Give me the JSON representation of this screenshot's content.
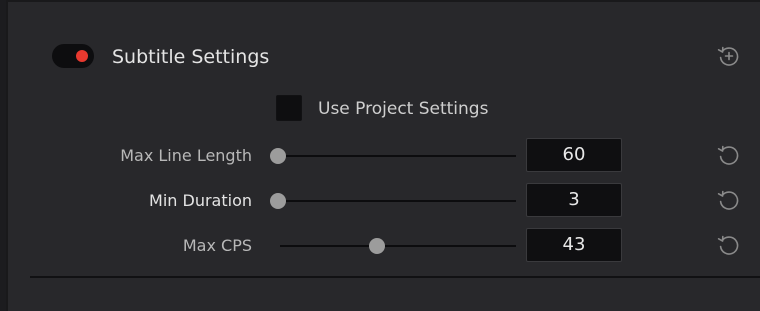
{
  "section": {
    "title": "Subtitle Settings",
    "enabled": true,
    "toggle_color": "#e8392f",
    "reset_all_icon": "reset-add-icon"
  },
  "project_settings": {
    "label": "Use Project Settings",
    "checked": false
  },
  "rows": [
    {
      "label": "Max Line Length",
      "value": "60",
      "slider_fraction": 0.0,
      "reset_icon": "reset-icon"
    },
    {
      "label": "Min Duration",
      "value": "3",
      "slider_fraction": 0.0,
      "reset_icon": "reset-icon"
    },
    {
      "label": "Max CPS",
      "value": "43",
      "slider_fraction": 0.43,
      "reset_icon": "reset-icon"
    }
  ]
}
